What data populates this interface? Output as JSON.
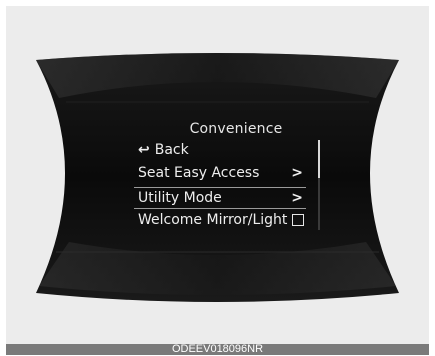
{
  "menu": {
    "title": "Convenience",
    "items": [
      {
        "label": "Back",
        "icon": "back-arrow-icon",
        "glyph": "↩"
      },
      {
        "label": "Seat Easy Access",
        "chevron": ">"
      },
      {
        "label": "Utility Mode",
        "chevron": ">",
        "selected": true
      },
      {
        "label": "Welcome Mirror/Light",
        "checkbox_checked": false
      }
    ],
    "scroll_position": 0.0
  },
  "caption": "ODEEV018096NR",
  "colors": {
    "background": "#ececec",
    "display_dark": "#0e0e0e",
    "text": "#ededed",
    "caption_bar": "#7a7a7a"
  }
}
